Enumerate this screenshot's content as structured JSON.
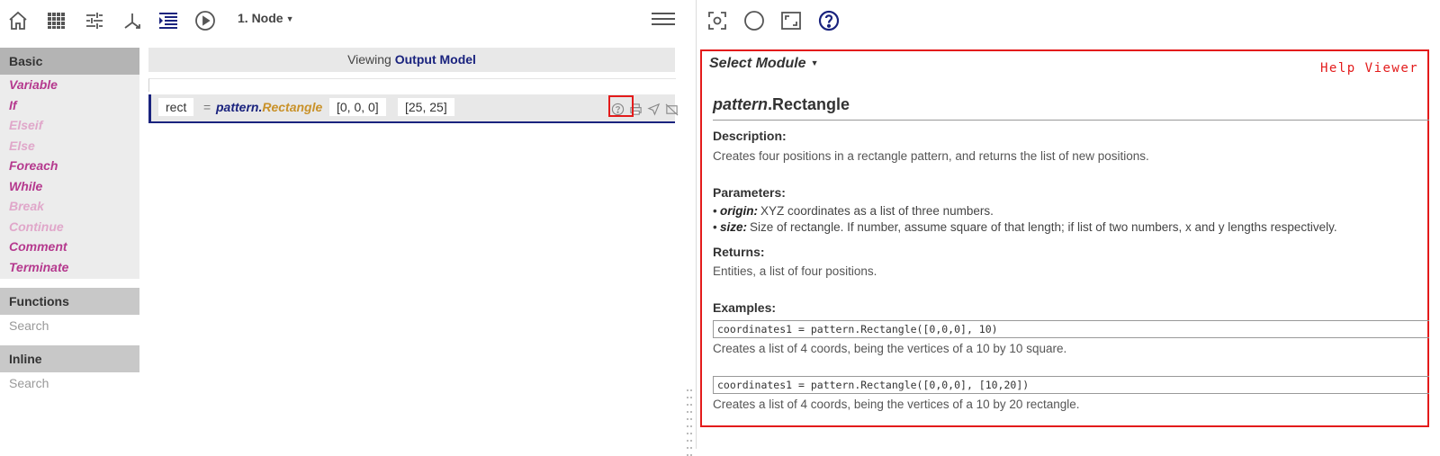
{
  "toolbar": {
    "icons": [
      "home-icon",
      "grid-icon",
      "settings-sliders-icon",
      "merge-icon",
      "indent-list-icon",
      "play-icon"
    ],
    "node_select": "1. Node",
    "menu_icon": "hamburger-icon"
  },
  "right_toolbar": {
    "icons": [
      "focus-screenshot-icon",
      "circle-icon",
      "fullscreen-icon",
      "help-icon"
    ]
  },
  "sidebar": {
    "basic_title": "Basic",
    "basic_items": [
      {
        "label": "Variable",
        "enabled": true
      },
      {
        "label": "If",
        "enabled": true
      },
      {
        "label": "Elseif",
        "enabled": false
      },
      {
        "label": "Else",
        "enabled": false
      },
      {
        "label": "Foreach",
        "enabled": true
      },
      {
        "label": "While",
        "enabled": true
      },
      {
        "label": "Break",
        "enabled": false
      },
      {
        "label": "Continue",
        "enabled": false
      },
      {
        "label": "Comment",
        "enabled": true
      },
      {
        "label": "Terminate",
        "enabled": true
      }
    ],
    "functions_title": "Functions",
    "functions_search": "Search",
    "inline_title": "Inline",
    "inline_search": "Search"
  },
  "viewer": {
    "viewing_prefix": "Viewing",
    "viewing_target": "Output Model"
  },
  "code_line": {
    "variable": "rect",
    "equals": "=",
    "module": "pattern.",
    "function": "Rectangle",
    "arg1": "[0, 0, 0]",
    "arg2": "[25, 25]",
    "icons": [
      "help-circle-icon",
      "print-icon",
      "send-icon",
      "disable-icon"
    ]
  },
  "help": {
    "select_module": "Select Module",
    "label": "Help Viewer",
    "title_module": "pattern",
    "title_fn": ".Rectangle",
    "description_h": "Description:",
    "description": "Creates four positions in a rectangle pattern, and returns the list of new positions.",
    "parameters_h": "Parameters:",
    "params": [
      {
        "name": "origin:",
        "text": "XYZ coordinates as a list of three numbers."
      },
      {
        "name": "size:",
        "text": "Size of rectangle. If number, assume square of that length; if list of two numbers, x and y lengths respectively."
      }
    ],
    "returns_h": "Returns:",
    "returns": "Entities, a list of four positions.",
    "examples_h": "Examples:",
    "examples": [
      {
        "code": "coordinates1 = pattern.Rectangle([0,0,0], 10)",
        "text": "Creates a list of 4 coords, being the vertices of a 10 by 10 square."
      },
      {
        "code": "coordinates1 = pattern.Rectangle([0,0,0], [10,20])",
        "text": "Creates a list of 4 coords, being the vertices of a 10 by 20 rectangle."
      }
    ]
  },
  "colors": {
    "accent_navy": "#1a237e",
    "basic_item": "#b5398e",
    "basic_item_disabled": "#e0a7ca",
    "function_gold": "#c9922a",
    "highlight_red": "#e31b1b"
  }
}
